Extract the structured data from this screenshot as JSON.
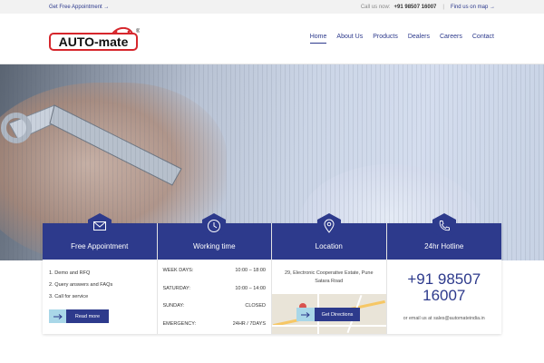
{
  "topbar": {
    "appointment": "Get Free Appointment →",
    "call_label": "Call us now:",
    "phone": "+91 98507 16007",
    "separator": "|",
    "map_link": "Find us on map →"
  },
  "logo": {
    "text": "AUTO-mate",
    "registered": "®"
  },
  "nav": {
    "items": [
      "Home",
      "About Us",
      "Products",
      "Dealers",
      "Careers",
      "Contact"
    ],
    "active": "Home"
  },
  "cards": {
    "appointment": {
      "title": "Free Appointment",
      "icon": "envelope-icon",
      "items": [
        "1.  Demo and RFQ",
        "2.  Query answers and FAQs",
        "3.  Call for service"
      ],
      "button": "Read more"
    },
    "hours": {
      "title": "Working time",
      "icon": "clock-icon",
      "rows": [
        {
          "day": "WEEK DAYS:",
          "time": "10:00 – 18:00"
        },
        {
          "day": "SATURDAY:",
          "time": "10:00 – 14:00"
        },
        {
          "day": "SUNDAY:",
          "time": "CLOSED"
        },
        {
          "day": "EMERGENCY:",
          "time": "24HR / 7DAYS"
        }
      ]
    },
    "location": {
      "title": "Location",
      "icon": "map-pin-icon",
      "address": "29, Electronic Cooperative Estate, Pune Satara Road",
      "button": "Get Directions"
    },
    "hotline": {
      "title": "24hr Hotline",
      "icon": "phone-icon",
      "number": "+91 98507 16007",
      "email_line": "or email us at sales@automateindia.in"
    }
  },
  "colors": {
    "brand_blue": "#2d3a8c",
    "accent_light": "#a9d7e8",
    "logo_red": "#d6262c"
  }
}
